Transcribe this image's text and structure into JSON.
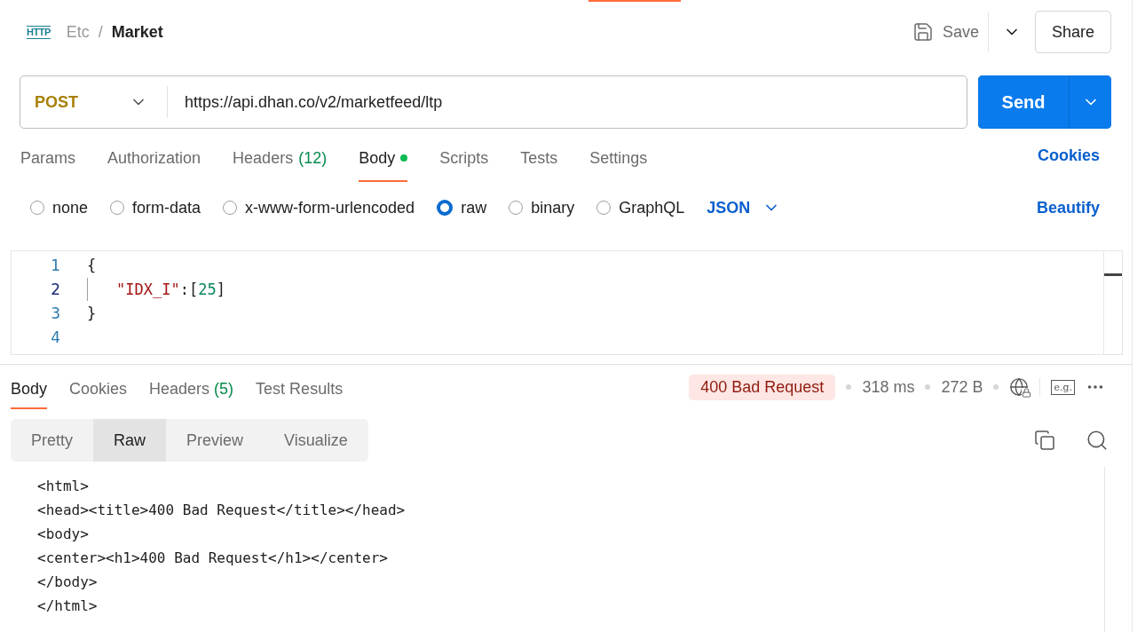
{
  "header": {
    "logo_text": "HTTP",
    "breadcrumb": [
      {
        "label": "Etc",
        "current": false
      },
      {
        "label": "Market",
        "current": true
      }
    ],
    "separator": "/",
    "save": "Save",
    "share": "Share"
  },
  "request": {
    "method": "POST",
    "url": "https://api.dhan.co/v2/marketfeed/ltp",
    "send": "Send"
  },
  "request_tabs": [
    {
      "label": "Params",
      "selected": false
    },
    {
      "label": "Authorization",
      "selected": false
    },
    {
      "label": "Headers",
      "count": "(12)",
      "selected": false
    },
    {
      "label": "Body",
      "selected": true,
      "dot": true
    },
    {
      "label": "Scripts",
      "selected": false
    },
    {
      "label": "Tests",
      "selected": false
    },
    {
      "label": "Settings",
      "selected": false
    }
  ],
  "cookies_link": "Cookies",
  "body_types": [
    {
      "label": "none",
      "selected": false
    },
    {
      "label": "form-data",
      "selected": false
    },
    {
      "label": "x-www-form-urlencoded",
      "selected": false
    },
    {
      "label": "raw",
      "selected": true
    },
    {
      "label": "binary",
      "selected": false
    },
    {
      "label": "GraphQL",
      "selected": false
    }
  ],
  "format": "JSON",
  "beautify": "Beautify",
  "editor_lines": [
    {
      "number": "1",
      "tokens": [
        {
          "kind": "punct",
          "text": "{"
        }
      ]
    },
    {
      "number": "2",
      "indent": true,
      "tokens": [
        {
          "kind": "key",
          "text": "\"IDX_I\""
        },
        {
          "kind": "punct",
          "text": ":["
        },
        {
          "kind": "number",
          "text": "25"
        },
        {
          "kind": "punct",
          "text": "]"
        }
      ]
    },
    {
      "number": "3",
      "tokens": [
        {
          "kind": "punct",
          "text": "}"
        }
      ]
    },
    {
      "number": "4"
    }
  ],
  "response_tabs": [
    {
      "label": "Body",
      "selected": true
    },
    {
      "label": "Cookies",
      "selected": false
    },
    {
      "label": "Headers",
      "count": "(5)",
      "selected": false
    },
    {
      "label": "Test Results",
      "selected": false
    }
  ],
  "status": {
    "code": "400 Bad Request",
    "time": "318 ms",
    "size": "272 B",
    "example_icon_text": "e.g."
  },
  "view_modes": [
    {
      "label": "Pretty",
      "selected": false
    },
    {
      "label": "Raw",
      "selected": true
    },
    {
      "label": "Preview",
      "selected": false
    },
    {
      "label": "Visualize",
      "selected": false
    }
  ],
  "response_lines": [
    "<html>",
    "<head><title>400 Bad Request</title></head>",
    "<body>",
    "<center><h1>400 Bad Request</h1></center>",
    "</body>",
    "</html>"
  ]
}
